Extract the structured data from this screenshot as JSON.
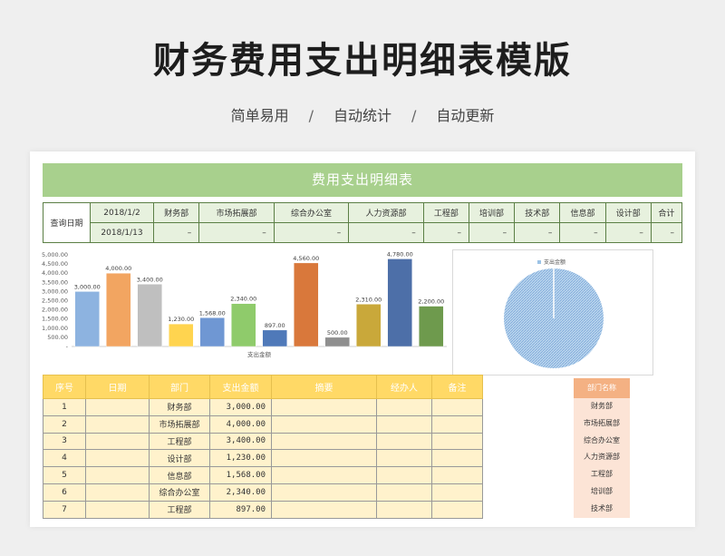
{
  "page": {
    "title": "财务费用支出明细表模版",
    "tagline": [
      "简单易用",
      "自动统计",
      "自动更新"
    ],
    "separator": "/"
  },
  "sheet": {
    "header_title": "费用支出明细表",
    "query": {
      "label": "查询日期",
      "start_date": "2018/1/2",
      "end_date": "2018/1/13",
      "columns": [
        "财务部",
        "市场拓展部",
        "综合办公室",
        "人力资源部",
        "工程部",
        "培训部",
        "技术部",
        "信息部",
        "设计部",
        "合计"
      ],
      "values": [
        "–",
        "–",
        "–",
        "–",
        "–",
        "–",
        "–",
        "–",
        "–",
        "–"
      ]
    }
  },
  "chart_data": [
    {
      "type": "bar",
      "categories": [
        "",
        "",
        "",
        "",
        "",
        "",
        "",
        "",
        "",
        "",
        "",
        ""
      ],
      "values": [
        3000,
        4000,
        3400,
        1230,
        1568,
        2340,
        897,
        4560,
        500,
        2310,
        4780,
        2200
      ],
      "value_labels": [
        "3,000.00",
        "4,000.00",
        "3,400.00",
        "1,230.00",
        "1,568.00",
        "2,340.00",
        "897.00",
        "4,560.00",
        "500.00",
        "2,310.00",
        "4,780.00",
        "2,200.00"
      ],
      "colors": [
        "#8db3e0",
        "#f2a561",
        "#bfbfbf",
        "#ffd44f",
        "#6f97d3",
        "#8fcb6b",
        "#4f79b9",
        "#d9783b",
        "#8f8f8f",
        "#c9a83a",
        "#4d6fa8",
        "#6e9a4d"
      ],
      "xlabel": "支出金额",
      "ylabel": "",
      "ylim": [
        0,
        5000
      ],
      "yticks": [
        0,
        500,
        1000,
        1500,
        2000,
        2500,
        3000,
        3500,
        4000,
        4500,
        5000
      ],
      "ytick_labels": [
        "-",
        "500.00",
        "1,000.00",
        "1,500.00",
        "2,000.00",
        "2,500.00",
        "3,000.00",
        "3,500.00",
        "4,000.00",
        "4,500.00",
        "5,000.00"
      ]
    },
    {
      "type": "pie",
      "legend": [
        "支出金额"
      ],
      "legend_position": "top",
      "values": [
        1
      ],
      "colors": [
        "#9dc3e6"
      ]
    }
  ],
  "detail_table": {
    "headers": [
      "序号",
      "日期",
      "部门",
      "支出金额",
      "摘要",
      "经办人",
      "备注"
    ],
    "rows": [
      {
        "no": "1",
        "date": "",
        "dept": "财务部",
        "amount": "3,000.00",
        "summary": "",
        "handler": "",
        "note": ""
      },
      {
        "no": "2",
        "date": "",
        "dept": "市场拓展部",
        "amount": "4,000.00",
        "summary": "",
        "handler": "",
        "note": ""
      },
      {
        "no": "3",
        "date": "",
        "dept": "工程部",
        "amount": "3,400.00",
        "summary": "",
        "handler": "",
        "note": ""
      },
      {
        "no": "4",
        "date": "",
        "dept": "设计部",
        "amount": "1,230.00",
        "summary": "",
        "handler": "",
        "note": ""
      },
      {
        "no": "5",
        "date": "",
        "dept": "信息部",
        "amount": "1,568.00",
        "summary": "",
        "handler": "",
        "note": ""
      },
      {
        "no": "6",
        "date": "",
        "dept": "综合办公室",
        "amount": "2,340.00",
        "summary": "",
        "handler": "",
        "note": ""
      },
      {
        "no": "7",
        "date": "",
        "dept": "工程部",
        "amount": "897.00",
        "summary": "",
        "handler": "",
        "note": ""
      }
    ]
  },
  "department_list": {
    "header": "部门名称",
    "items": [
      "财务部",
      "市场拓展部",
      "综合办公室",
      "人力资源部",
      "工程部",
      "培训部",
      "技术部"
    ]
  },
  "colors": {
    "green_header": "#a8d08d",
    "query_border": "#5b7f45",
    "detail_header": "#ffd966",
    "detail_body": "#fff2cc",
    "dept_header": "#f4b183",
    "dept_body": "#fce4d6"
  }
}
